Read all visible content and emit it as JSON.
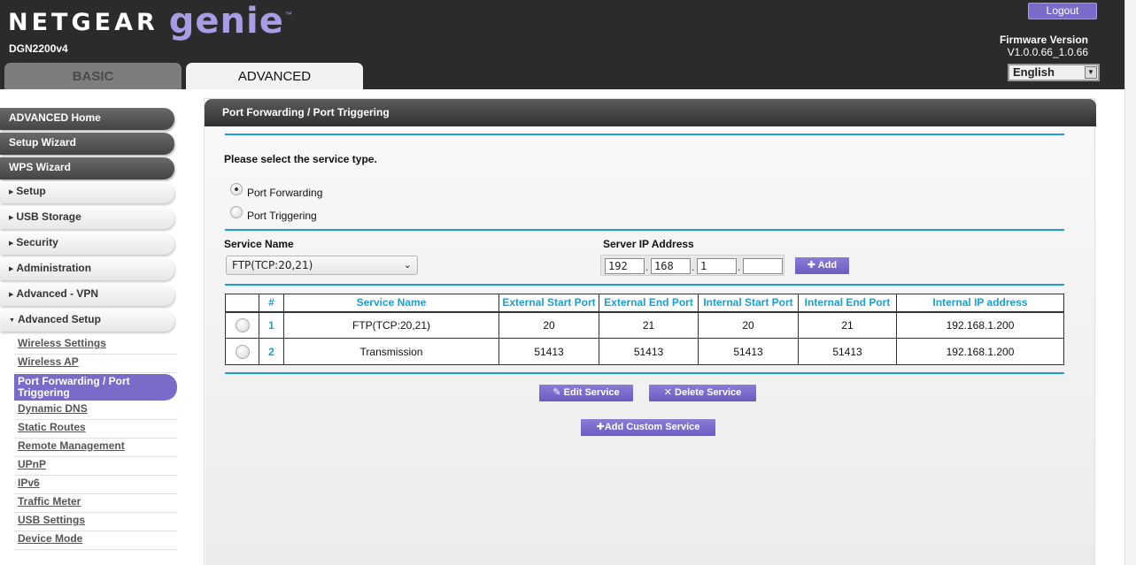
{
  "header": {
    "brand": "NETGEAR",
    "product": "genie",
    "tm": "™",
    "model": "DGN2200v4",
    "logout_label": "Logout",
    "firmware_label": "Firmware Version",
    "firmware_value": "V1.0.0.66_1.0.66",
    "language": "English",
    "tabs": {
      "basic": "BASIC",
      "advanced": "ADVANCED"
    }
  },
  "sidebar": {
    "top_items": [
      "ADVANCED Home",
      "Setup Wizard",
      "WPS Wizard"
    ],
    "sections": [
      "Setup",
      "USB Storage",
      "Security",
      "Administration",
      "Advanced - VPN",
      "Advanced Setup"
    ],
    "sub_items": [
      "Wireless Settings",
      "Wireless AP",
      "Port Forwarding / Port Triggering",
      "Dynamic DNS",
      "Static Routes",
      "Remote Management",
      "UPnP",
      "IPv6",
      "Traffic Meter",
      "USB Settings",
      "Device Mode"
    ],
    "active_sub": "Port Forwarding / Port Triggering"
  },
  "main": {
    "title": "Port Forwarding / Port Triggering",
    "service_type_prompt": "Please select the service type.",
    "radio_forwarding": "Port Forwarding",
    "radio_triggering": "Port Triggering",
    "service_name_label": "Service Name",
    "service_name_value": "FTP(TCP:20,21)",
    "server_ip_label": "Server IP Address",
    "ip": [
      "192",
      "168",
      "1",
      ""
    ],
    "add_label": "Add",
    "table": {
      "headers": [
        "#",
        "Service Name",
        "External Start Port",
        "External End Port",
        "Internal Start Port",
        "Internal End Port",
        "Internal IP address"
      ],
      "rows": [
        [
          "1",
          "FTP(TCP:20,21)",
          "20",
          "21",
          "20",
          "21",
          "192.168.1.200"
        ],
        [
          "2",
          "Transmission",
          "51413",
          "51413",
          "51413",
          "51413",
          "192.168.1.200"
        ]
      ]
    },
    "edit_label": "Edit Service",
    "delete_label": "Delete Service",
    "add_custom_label": "Add Custom Service"
  },
  "colors": {
    "accent": "#7a6bc9",
    "rule": "#1e9ed0",
    "header_bg": "#2b2b2b"
  }
}
